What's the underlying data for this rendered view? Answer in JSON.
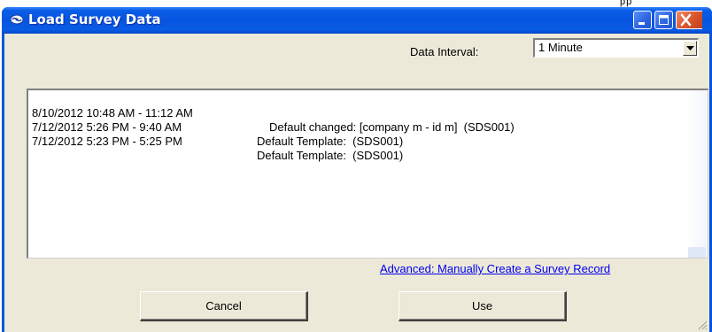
{
  "top_strip": {
    "text": "pp"
  },
  "window": {
    "title": "Load Survey Data",
    "icon": "survey-app-icon",
    "controls": [
      "minimize-icon",
      "maximize-icon",
      "close-icon"
    ]
  },
  "data_interval": {
    "label": "Data Interval:",
    "value": "1 Minute"
  },
  "survey_list": [
    {
      "time": "8/10/2012 10:48 AM - 11:12 AM",
      "description": "Default changed: [company m - id m]  (SDS001)"
    },
    {
      "time": "7/12/2012 5:26 PM - 9:40 AM",
      "description": "Default Template:  (SDS001)"
    },
    {
      "time": "7/12/2012 5:23 PM - 5:25 PM",
      "description": "Default Template:  (SDS001)"
    }
  ],
  "advanced_link": "Advanced: Manually Create a Survey Record",
  "buttons": {
    "cancel": "Cancel",
    "use": "Use"
  },
  "colors": {
    "title_bar": "#0054e3",
    "client_background": "#ece9d8",
    "link": "#0000ee",
    "close_button": "#d8542c"
  }
}
